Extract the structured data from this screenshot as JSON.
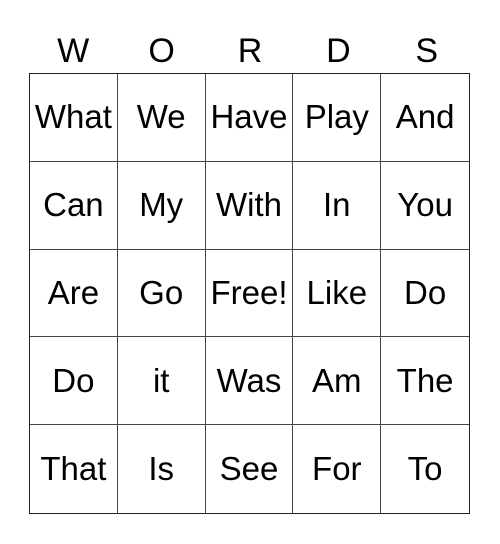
{
  "card": {
    "header": [
      "W",
      "O",
      "R",
      "D",
      "S"
    ],
    "rows": [
      [
        "What",
        "We",
        "Have",
        "Play",
        "And"
      ],
      [
        "Can",
        "My",
        "With",
        "In",
        "You"
      ],
      [
        "Are",
        "Go",
        "Free!",
        "Like",
        "Do"
      ],
      [
        "Do",
        "it",
        "Was",
        "Am",
        "The"
      ],
      [
        "That",
        "Is",
        "See",
        "For",
        "To"
      ]
    ]
  }
}
